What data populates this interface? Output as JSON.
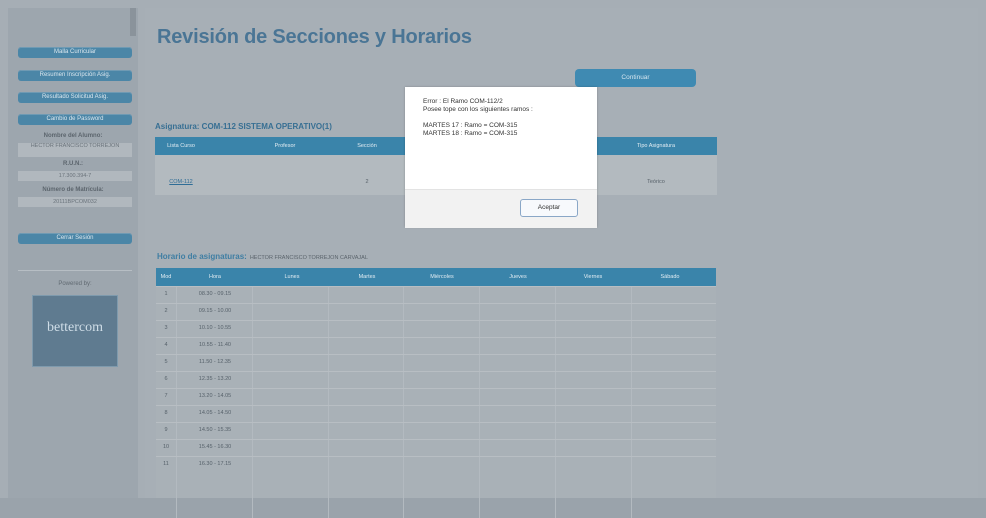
{
  "sidebar": {
    "buttons": [
      "Malla Curricular",
      "Resumen Inscripción Asig.",
      "Resultado Solicitud Asig.",
      "Cambio de Password"
    ],
    "student_name_label": "Nombre del Alumno:",
    "student_name": "HECTOR FRANCISCO TORREJON",
    "rut_label": "R.U.N.:",
    "rut": "17.300.394-7",
    "enrollment_label": "Número de Matrícula:",
    "enrollment": "20111BPCOM032",
    "logout": "Cerrar Sesión",
    "powered_label": "Powered by:",
    "logo_text": "bettercom"
  },
  "main": {
    "title": "Revisión de Secciones y Horarios",
    "continue_button": "Continuar",
    "subject_title": "Asignatura: COM-112 SISTEMA OPERATIVO(1)",
    "subject_headers": [
      "Lista Curso",
      "Profesor",
      "Sección",
      "Tipo Asignatura"
    ],
    "subject_row": {
      "code": "COM-112",
      "section": "2",
      "type": "Teórico"
    },
    "schedule_title": "Horario de asignaturas:",
    "schedule_owner": "HECTOR FRANCISCO TORREJON CARVAJAL",
    "schedule_headers": [
      "Mod",
      "Hora",
      "Lunes",
      "Martes",
      "Miércoles",
      "Jueves",
      "Viernes",
      "Sábado"
    ],
    "schedule_rows": [
      {
        "mod": "1",
        "time": "08.30 - 09.15"
      },
      {
        "mod": "2",
        "time": "09.15 - 10.00"
      },
      {
        "mod": "3",
        "time": "10.10 - 10.55"
      },
      {
        "mod": "4",
        "time": "10.55 - 11.40"
      },
      {
        "mod": "5",
        "time": "11.50 - 12.35"
      },
      {
        "mod": "6",
        "time": "12.35 - 13.20"
      },
      {
        "mod": "7",
        "time": "13.20 - 14.05"
      },
      {
        "mod": "8",
        "time": "14.05 - 14.50"
      },
      {
        "mod": "9",
        "time": "14.50 - 15.35"
      },
      {
        "mod": "10",
        "time": "15.45 - 16.30"
      },
      {
        "mod": "11",
        "time": "16.30 - 17.15"
      }
    ]
  },
  "dialog": {
    "message": "Error : El Ramo COM-112/2\nPosee tope con los siguientes ramos :\n\nMARTES 17 : Ramo = COM-315\nMARTES 18 : Ramo = COM-315",
    "accept": "Aceptar"
  },
  "colors": {
    "accent": "#3a84aa",
    "overlay_page": "#a7afb6",
    "dialog_bg": "#ffffff"
  }
}
